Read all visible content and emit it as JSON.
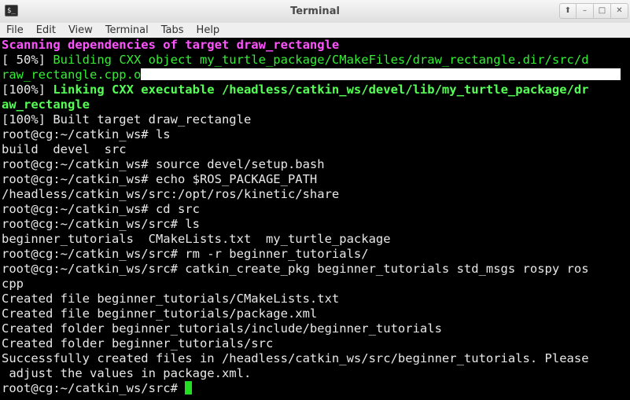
{
  "window": {
    "title": "Terminal",
    "icon_glyph": "$_",
    "buttons": [
      "⬆",
      "–",
      "□",
      "✕"
    ]
  },
  "menubar": {
    "items": [
      "File",
      "Edit",
      "View",
      "Terminal",
      "Tabs",
      "Help"
    ]
  },
  "terminal": {
    "line1": "Scanning dependencies of target draw_rectangle",
    "line2_prefix": "[ 50%] ",
    "line2_text": "Building CXX object my_turtle_package/CMakeFiles/draw_rectangle.dir/src/d",
    "line3_text": "raw_rectangle.cpp.o",
    "line4_prefix": "[100%] ",
    "line4_text": "Linking CXX executable /headless/catkin_ws/devel/lib/my_turtle_package/dr",
    "line5_text": "aw_rectangle",
    "line6": "[100%] Built target draw_rectangle",
    "line7": "root@cg:~/catkin_ws# ls",
    "line8": "build  devel  src",
    "line9": "root@cg:~/catkin_ws# source devel/setup.bash",
    "line10": "root@cg:~/catkin_ws# echo $ROS_PACKAGE_PATH",
    "line11": "/headless/catkin_ws/src:/opt/ros/kinetic/share",
    "line12": "root@cg:~/catkin_ws# cd src",
    "line13": "root@cg:~/catkin_ws/src# ls",
    "line14": "beginner_tutorials  CMakeLists.txt  my_turtle_package",
    "line15": "root@cg:~/catkin_ws/src# rm -r beginner_tutorials/",
    "line16": "root@cg:~/catkin_ws/src# catkin_create_pkg beginner_tutorials std_msgs rospy ros",
    "line17": "cpp",
    "line18": "Created file beginner_tutorials/CMakeLists.txt",
    "line19": "Created file beginner_tutorials/package.xml",
    "line20": "Created folder beginner_tutorials/include/beginner_tutorials",
    "line21": "Created folder beginner_tutorials/src",
    "line22": "Successfully created files in /headless/catkin_ws/src/beginner_tutorials. Please",
    "line23": " adjust the values in package.xml.",
    "line24": "root@cg:~/catkin_ws/src# "
  },
  "colors": {
    "background": "#000000",
    "foreground": "#e8e8e8",
    "magenta_bold": "#ff55ff",
    "green": "#33ee33",
    "bright_green": "#55ff55",
    "cursor": "#22dd22"
  }
}
